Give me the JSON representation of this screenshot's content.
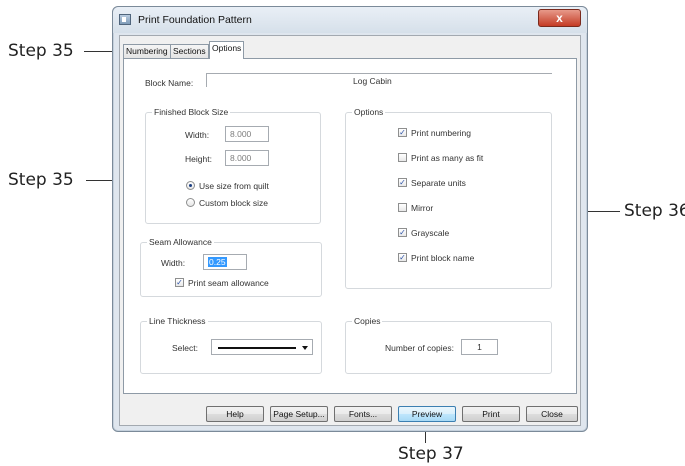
{
  "window": {
    "title": "Print Foundation Pattern",
    "close_glyph": "x"
  },
  "tabs": [
    {
      "label": "Numbering"
    },
    {
      "label": "Sections"
    },
    {
      "label": "Options"
    }
  ],
  "block_name": {
    "label": "Block Name:",
    "value": "Log Cabin"
  },
  "finished_block_size": {
    "title": "Finished Block Size",
    "width_label": "Width:",
    "width_value": "8.000",
    "height_label": "Height:",
    "height_value": "8.000",
    "radio_use_quilt": "Use size from quilt",
    "radio_custom": "Custom block size"
  },
  "options": {
    "title": "Options",
    "items": [
      {
        "label": "Print numbering",
        "checked": true
      },
      {
        "label": "Print as many as fit",
        "checked": false
      },
      {
        "label": "Separate units",
        "checked": true
      },
      {
        "label": "Mirror",
        "checked": false
      },
      {
        "label": "Grayscale",
        "checked": true
      },
      {
        "label": "Print block name",
        "checked": true
      }
    ]
  },
  "seam_allowance": {
    "title": "Seam Allowance",
    "width_label": "Width:",
    "width_value": "0.25",
    "print_label": "Print seam allowance"
  },
  "line_thickness": {
    "title": "Line Thickness",
    "select_label": "Select:"
  },
  "copies": {
    "title": "Copies",
    "label": "Number of copies:",
    "value": "1"
  },
  "buttons": {
    "help": "Help",
    "page_setup": "Page Setup...",
    "fonts": "Fonts...",
    "preview": "Preview",
    "print": "Print",
    "close": "Close"
  },
  "callouts": {
    "step35_tab": "Step 35",
    "step35_radio": "Step 35",
    "step36": "Step 36",
    "step37": "Step 37"
  },
  "colors": {
    "check": "#2e54a8",
    "selection": "#3399ff",
    "window_frame": "#dfe6ee",
    "close_red": "#c43b25"
  }
}
